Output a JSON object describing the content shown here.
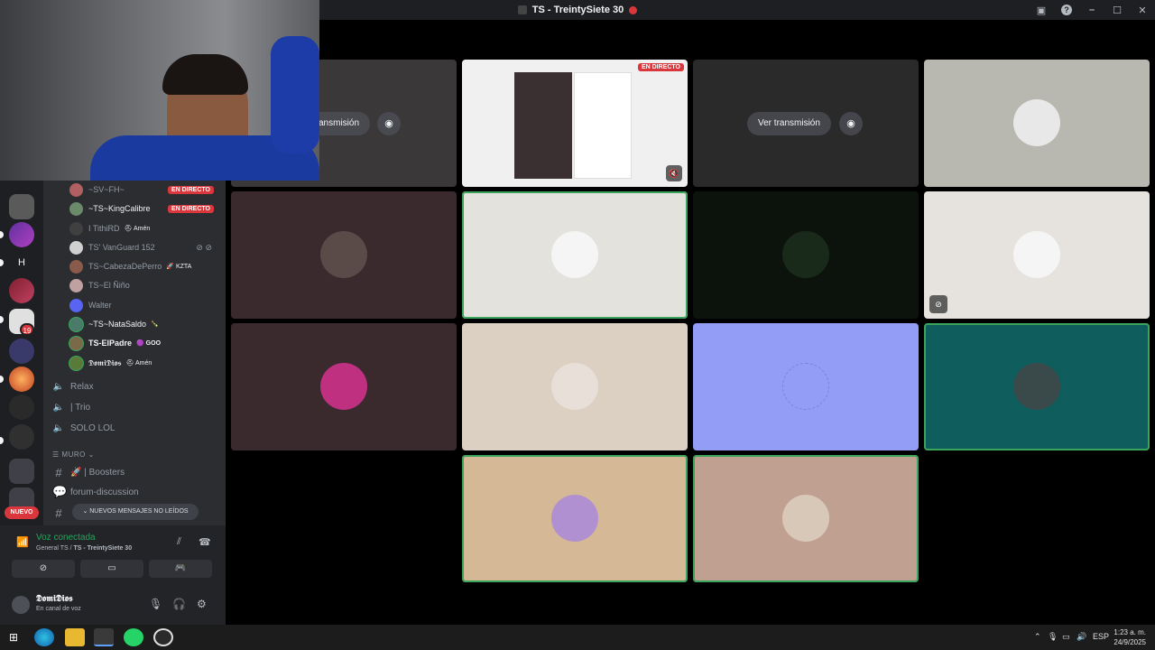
{
  "window": {
    "title": "TS - TreintySiete 30",
    "help_icon": "help-icon",
    "minimize": "–",
    "maximize": "☐",
    "close": "✕"
  },
  "members": [
    {
      "name": "~SV~FH~",
      "live": "EN DIRECTO",
      "color": "#b06060"
    },
    {
      "name": "~TS~KingCalibre",
      "live": "EN DIRECTO",
      "color": "#6a8a6a"
    },
    {
      "name": "I TithiRD",
      "tag": "⛑ Amén",
      "color": "#404040"
    },
    {
      "name": "TS' VanGuard 152",
      "color": "#d0d0d0"
    },
    {
      "name": "TS~CabezaDePerro",
      "tag": "🚀 KZTA",
      "color": "#8a5a4a"
    },
    {
      "name": "TS~El Ñiño",
      "color": "#c0a0a0"
    },
    {
      "name": "Walter",
      "color": "#5865f2"
    },
    {
      "name": "~TS~NataSaldo",
      "tag": "🍾",
      "color": "#4a7a6a"
    },
    {
      "name": "TS-ElPadre",
      "tag": "🟣 GOO",
      "color": "#7a6a4a"
    },
    {
      "name": "𝕯𝖔𝖒𝖎𝕯𝖎𝖔𝖘",
      "tag": "⛑ Amén",
      "color": "#5a7a3a"
    }
  ],
  "voice_channels": [
    {
      "name": "Relax"
    },
    {
      "name": "| Trio"
    },
    {
      "name": "SOLO LOL"
    }
  ],
  "category": {
    "name": "MURO"
  },
  "text_channels": [
    {
      "name": "🚀 | Boosters"
    },
    {
      "name": "forum-discussion"
    }
  ],
  "new_messages": "NUEVOS MENSAJES NO LEÍDOS",
  "rail": {
    "badge": "19",
    "nuevo": "NUEVO",
    "letter": "H"
  },
  "voice_panel": {
    "status": "Voz conectada",
    "sub_prefix": "General TS / ",
    "sub_channel": "TS - TreintySiete 30",
    "icons": [
      "signal-icon",
      "noise-suppression-icon",
      "disconnect-icon",
      "camera-off-icon",
      "screen-share-icon",
      "activity-icon"
    ]
  },
  "user_panel": {
    "name": "𝕯𝖔𝖒𝖎𝕯𝖎𝖔𝖘",
    "status": "En canal de voz"
  },
  "stage": {
    "watch_label": "Ver transmisión",
    "partial_watch_label": "ansmisión",
    "live_label": "EN DIRECTO"
  },
  "tile_colors": {
    "t1": "#3a3838",
    "t2": "#f0f0f0",
    "t3": "#2a2a2a",
    "t4": "#b8b8b0",
    "t5": "#3a2a2e",
    "t6": "#e3e2dd",
    "t7": "#0c130c",
    "t8": "#e6e3de",
    "t9": "#3a2a2e",
    "t10": "#dcd0c2",
    "t11": "#939df5",
    "t12": "#0f5d5d",
    "t13": "#d5b896",
    "t14": "#c0a090"
  },
  "taskbar": {
    "lang": "ESP",
    "time": "1:23 a. m.",
    "date": "24/9/2025"
  }
}
